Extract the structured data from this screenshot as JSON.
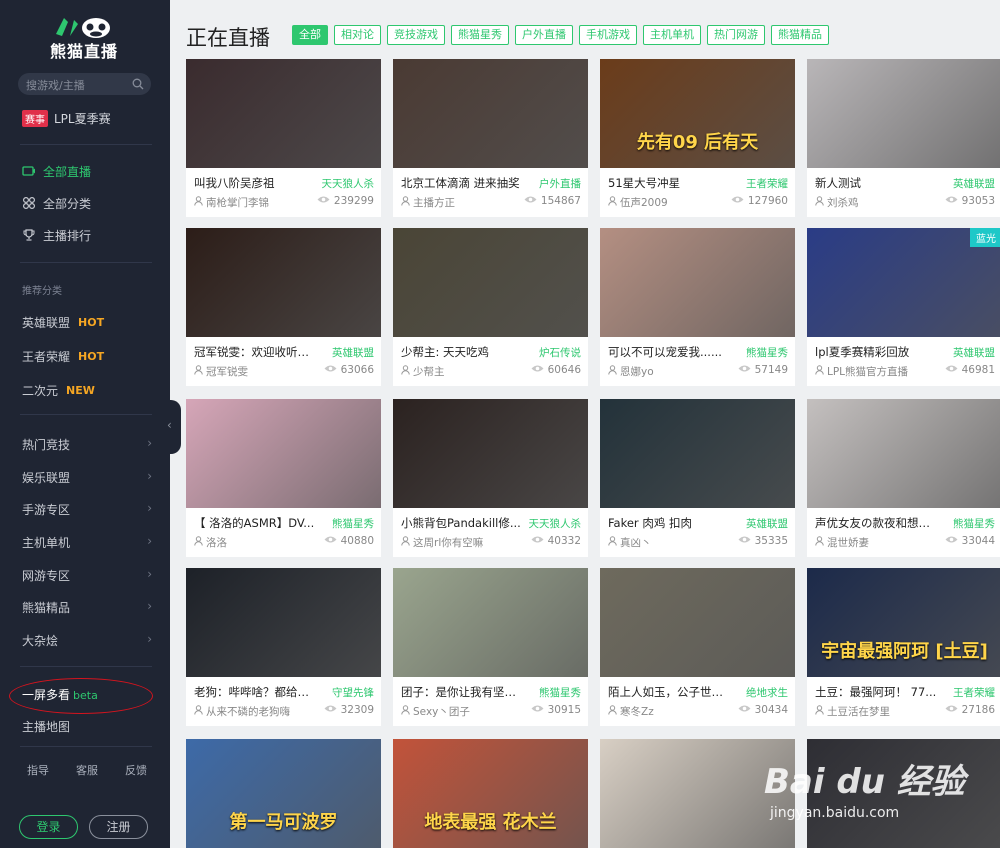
{
  "sidebar": {
    "logo_text": "熊猫直播",
    "search_placeholder": "搜游戏/主播",
    "match_badge": "赛事",
    "match_label": "LPL夏季赛",
    "nav": [
      "全部直播",
      "全部分类",
      "主播排行"
    ],
    "rec_title": "推荐分类",
    "rec": [
      {
        "label": "英雄联盟",
        "tag": "HOT"
      },
      {
        "label": "王者荣耀",
        "tag": "HOT"
      },
      {
        "label": "二次元",
        "tag": "NEW"
      }
    ],
    "categories": [
      "热门竞技",
      "娱乐联盟",
      "手游专区",
      "主机单机",
      "网游专区",
      "熊猫精品",
      "大杂烩"
    ],
    "multi_label": "一屏多看",
    "multi_beta": "beta",
    "map_label": "主播地图",
    "footer": [
      "指导",
      "客服",
      "反馈"
    ],
    "login": "登录",
    "register": "注册"
  },
  "main": {
    "title": "正在直播",
    "tabs": [
      "全部",
      "相对论",
      "竞技游戏",
      "熊猫星秀",
      "户外直播",
      "手机游戏",
      "主机单机",
      "热门网游",
      "熊猫精品"
    ],
    "active_tab": 0,
    "cards": [
      {
        "title": "叫我八阶吴彦祖",
        "cat": "天天狼人杀",
        "host": "南枪掌门李锦",
        "views": "239299",
        "thumb": "#3a2b2e"
      },
      {
        "title": "北京工体滴滴 进来抽奖",
        "cat": "户外直播",
        "host": "主播方正",
        "views": "154867",
        "thumb": "#4a3a33"
      },
      {
        "title": "51星大号冲星",
        "cat": "王者荣耀",
        "host": "伍声2009",
        "views": "127960",
        "thumb": "#6b3c1a",
        "overlay": "先有09 后有天"
      },
      {
        "title": "新人测试",
        "cat": "英雄联盟",
        "host": "刘杀鸡",
        "views": "93053",
        "thumb": "#b9b6b8"
      },
      {
        "title": "冠军锐雯：欢迎收听你...",
        "cat": "英雄联盟",
        "host": "冠军锐雯",
        "views": "63066",
        "thumb": "#2c1d18"
      },
      {
        "title": "少帮主: 天天吃鸡",
        "cat": "炉石传说",
        "host": "少帮主",
        "views": "60646",
        "thumb": "#4a4536"
      },
      {
        "title": "可以不可以宠爱我......",
        "cat": "熊猫星秀",
        "host": "恩娜yo",
        "views": "57149",
        "thumb": "#b48f82"
      },
      {
        "title": "lpl夏季赛精彩回放",
        "cat": "英雄联盟",
        "host": "LPL熊猫官方直播",
        "views": "46981",
        "thumb": "#2a3c86",
        "badge": "蓝光"
      },
      {
        "title": "【 洛洛的ASMR】DV...",
        "cat": "熊猫星秀",
        "host": "洛洛",
        "views": "40880",
        "thumb": "#d6a6b8"
      },
      {
        "title": "小熊背包Pandakill修...",
        "cat": "天天狼人杀",
        "host": "这周rl你有空嘛",
        "views": "40332",
        "thumb": "#2b2220"
      },
      {
        "title": "Faker 肉鸡 扣肉",
        "cat": "英雄联盟",
        "host": "真凶丶",
        "views": "35335",
        "thumb": "#23323a"
      },
      {
        "title": "声优女友の款夜和想你...",
        "cat": "熊猫星秀",
        "host": "混世娇妻",
        "views": "33044",
        "thumb": "#c4c0bf"
      },
      {
        "title": "老狗：哔哔啥？都给我...",
        "cat": "守望先锋",
        "host": "从来不磷的老狗嗨",
        "views": "32309",
        "thumb": "#1d2128"
      },
      {
        "title": "团子：是你让我有坚持...",
        "cat": "熊猫星秀",
        "host": "Sexy丶团子",
        "views": "30915",
        "thumb": "#9aa58e"
      },
      {
        "title": "陌上人如玉，公子世无...",
        "cat": "绝地求生",
        "host": "寒冬Zz",
        "views": "30434",
        "thumb": "#6e6a5d"
      },
      {
        "title": "土豆：最强阿珂！ 77...",
        "cat": "王者荣耀",
        "host": "土豆活在梦里",
        "views": "27186",
        "thumb": "#1c2a4a",
        "overlay": "宇宙最强阿珂 [土豆]"
      },
      {
        "thumb": "#3d6aa8",
        "overlay": "第一马可波罗"
      },
      {
        "thumb": "#c2533a",
        "overlay": "地表最强 花木兰"
      },
      {
        "thumb": "#d8cfc4"
      },
      {
        "thumb": "#2e2e34"
      }
    ]
  },
  "watermark": {
    "brand": "Bai du 经验",
    "url": "jingyan.baidu.com"
  }
}
